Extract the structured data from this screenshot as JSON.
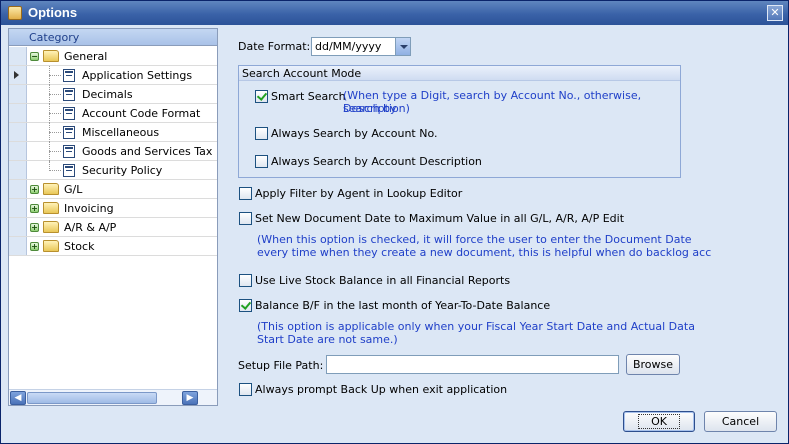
{
  "window": {
    "title": "Options",
    "close_glyph": "✕"
  },
  "tree": {
    "header": "Category",
    "items": [
      {
        "label": "General",
        "expander": "−"
      },
      {
        "label": "Application Settings"
      },
      {
        "label": "Decimals"
      },
      {
        "label": "Account Code Format"
      },
      {
        "label": "Miscellaneous"
      },
      {
        "label": "Goods and Services Tax"
      },
      {
        "label": "Security Policy"
      },
      {
        "label": "G/L",
        "expander": "+"
      },
      {
        "label": "Invoicing",
        "expander": "+"
      },
      {
        "label": "A/R & A/P",
        "expander": "+"
      },
      {
        "label": "Stock",
        "expander": "+"
      }
    ],
    "scroll_left": "◀",
    "scroll_right": "▶"
  },
  "date_format": {
    "label": "Date Format:",
    "value": "dd/MM/yyyy"
  },
  "search_mode": {
    "title": "Search Account Mode",
    "smart_search": {
      "label": "Smart Search",
      "checked": true
    },
    "smart_note_1": "(When type a Digit, search by Account No., otherwise, search by",
    "smart_note_2": "Description)",
    "always_no": {
      "label": "Always Search by Account No.",
      "checked": false
    },
    "always_desc": {
      "label": "Always Search by Account Description",
      "checked": false
    }
  },
  "options": {
    "apply_filter": {
      "label": "Apply Filter by Agent in Lookup Editor",
      "checked": false
    },
    "new_doc_date": {
      "label": "Set New Document Date to Maximum Value in all G/L, A/R, A/P Edit",
      "checked": false
    },
    "new_doc_note_1": "(When this option is checked, it will force the user to enter the Document Date",
    "new_doc_note_2": "every time when they create a new document, this is helpful when do backlog acc",
    "live_stock": {
      "label": "Use Live Stock Balance in all Financial Reports",
      "checked": false
    },
    "balance_bf": {
      "label": "Balance B/F in the last month of Year-To-Date Balance",
      "checked": true
    },
    "balance_note_1": "(This option is applicable only when your Fiscal Year Start Date and Actual Data",
    "balance_note_2": "Start Date are not same.)",
    "setup_path_label": "Setup File Path:",
    "setup_path_value": "",
    "browse": "Browse",
    "backup_prompt": {
      "label": "Always prompt Back Up when exit application",
      "checked": false
    }
  },
  "footer": {
    "ok": "OK",
    "cancel": "Cancel"
  }
}
